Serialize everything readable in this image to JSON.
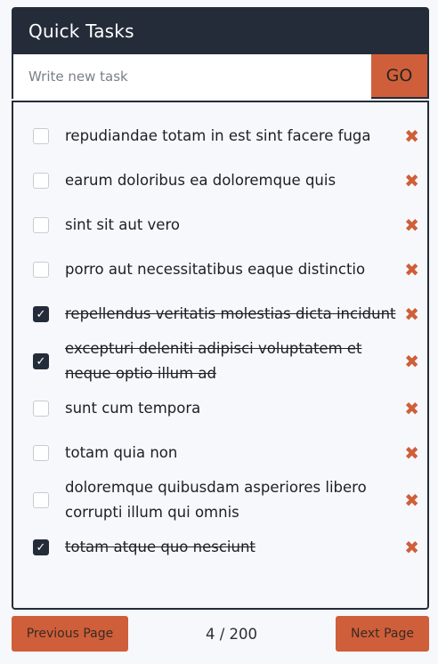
{
  "header": {
    "title": "Quick Tasks"
  },
  "new_task": {
    "placeholder": "Write new task",
    "go_label": "GO"
  },
  "tasks": [
    {
      "text": "repudiandae totam in est sint facere fuga",
      "done": false
    },
    {
      "text": "earum doloribus ea doloremque quis",
      "done": false
    },
    {
      "text": "sint sit aut vero",
      "done": false
    },
    {
      "text": "porro aut necessitatibus eaque distinctio",
      "done": false
    },
    {
      "text": "repellendus veritatis molestias dicta incidunt",
      "done": true
    },
    {
      "text": "excepturi deleniti adipisci voluptatem et neque optio illum ad",
      "done": true
    },
    {
      "text": "sunt cum tempora",
      "done": false
    },
    {
      "text": "totam quia non",
      "done": false
    },
    {
      "text": "doloremque quibusdam asperiores libero corrupti illum qui omnis",
      "done": false
    },
    {
      "text": "totam atque quo nesciunt",
      "done": true
    }
  ],
  "icons": {
    "delete": "close-icon",
    "check": "checkmark-icon"
  },
  "colors": {
    "accent": "#cf5f3a",
    "header": "#252c39",
    "background": "#f6f8fb"
  },
  "pager": {
    "prev_label": "Previous Page",
    "next_label": "Next Page",
    "indicator": "4 / 200",
    "current_page": 4,
    "total_pages": 200
  }
}
